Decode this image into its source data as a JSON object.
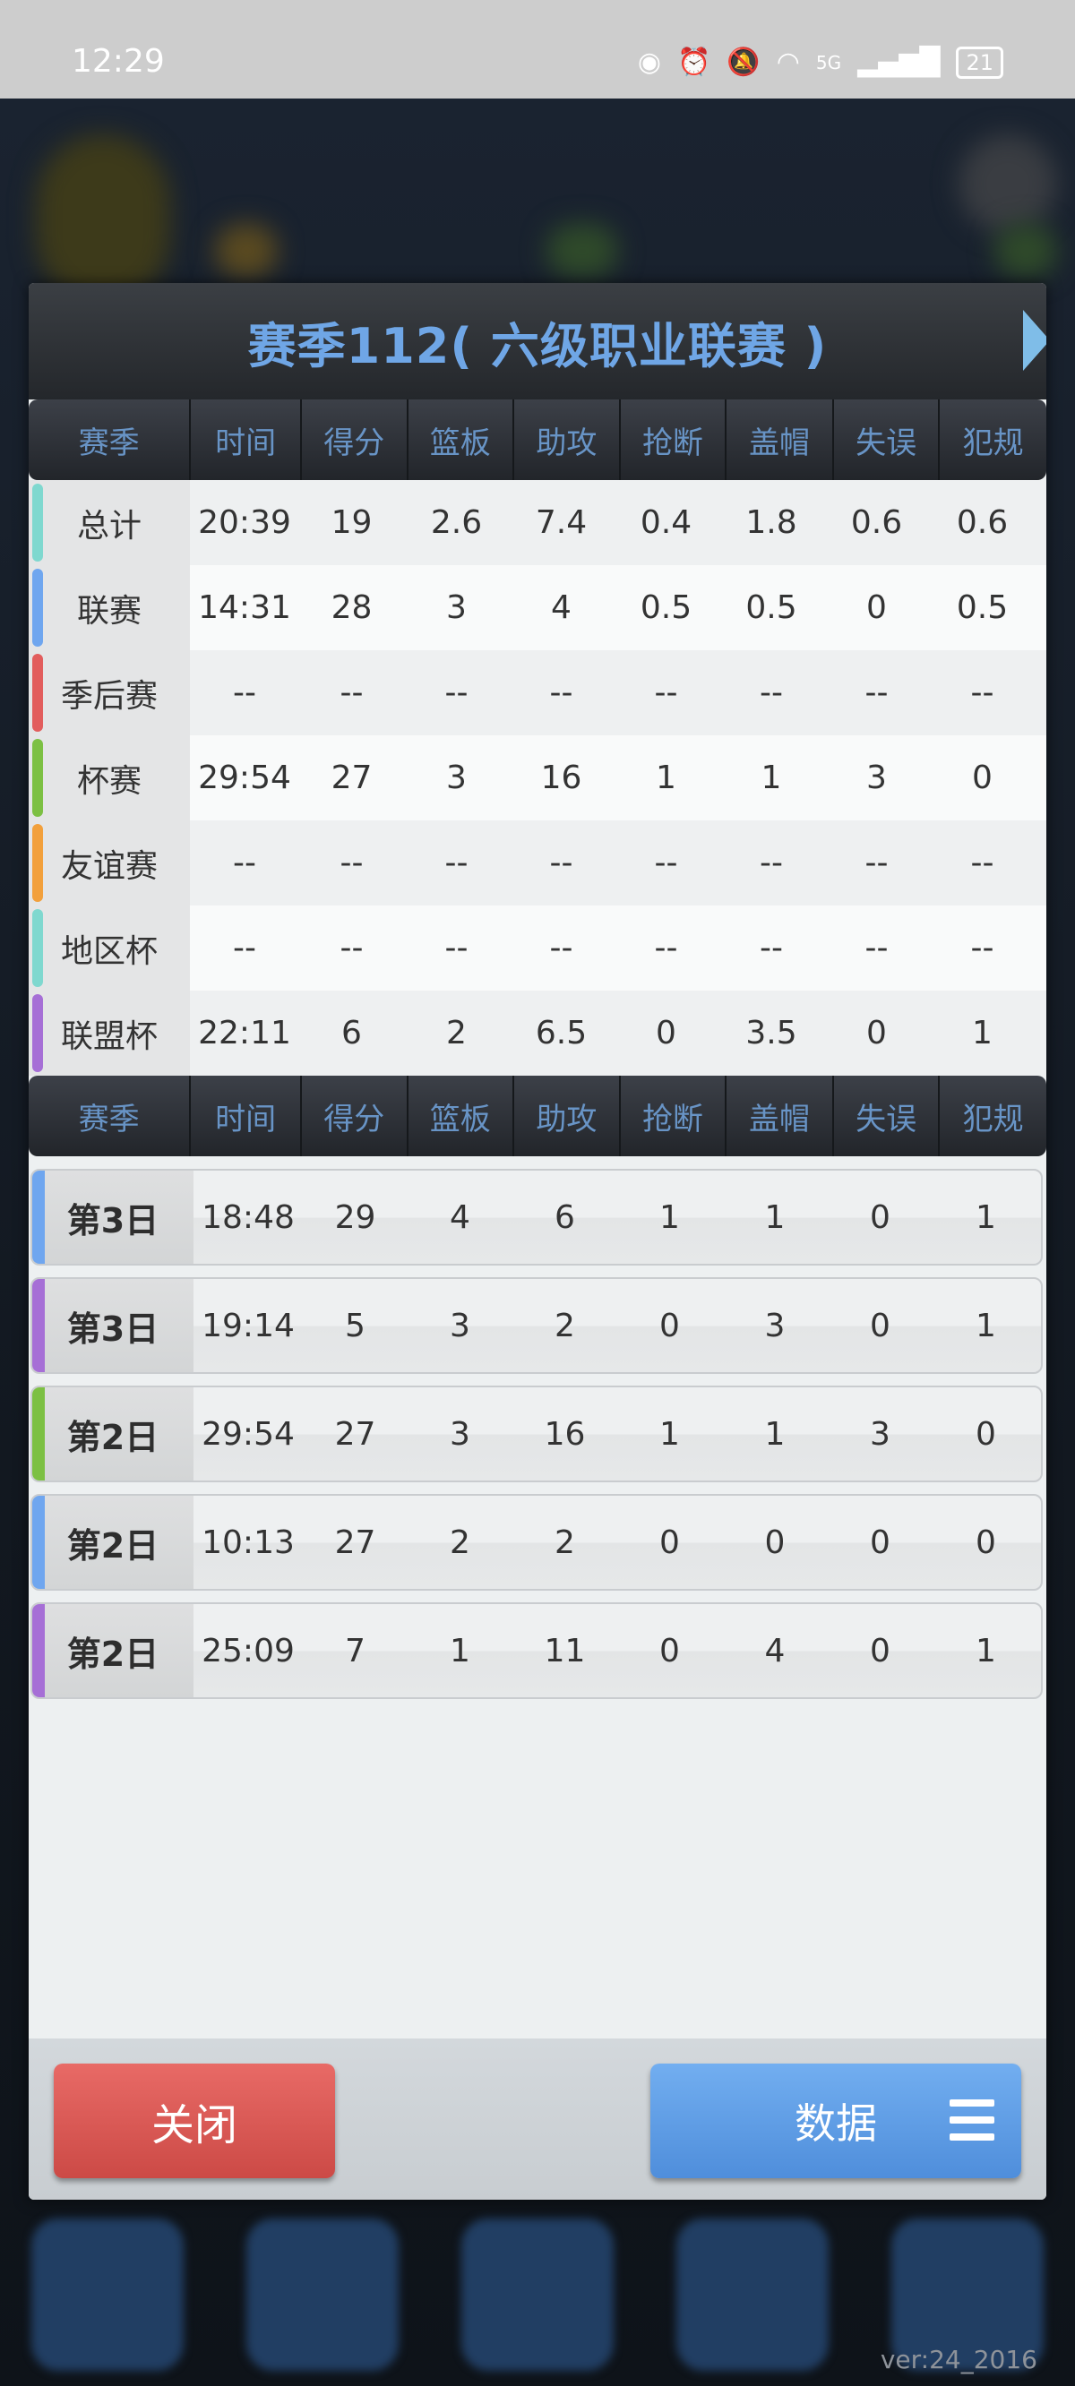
{
  "status_bar": {
    "time": "12:29",
    "battery": "21",
    "network": "5G"
  },
  "dialog": {
    "title": "赛季112( 六级职业联赛 )",
    "columns": [
      "赛季",
      "时间",
      "得分",
      "篮板",
      "助攻",
      "抢断",
      "盖帽",
      "失误",
      "犯规"
    ],
    "summary_rows": [
      {
        "label": "总计",
        "color": "#7fd8cf",
        "values": [
          "20:39",
          "19",
          "2.6",
          "7.4",
          "0.4",
          "1.8",
          "0.6",
          "0.6"
        ]
      },
      {
        "label": "联赛",
        "color": "#6fa6ef",
        "values": [
          "14:31",
          "28",
          "3",
          "4",
          "0.5",
          "0.5",
          "0",
          "0.5"
        ]
      },
      {
        "label": "季后赛",
        "color": "#e25d5d",
        "values": [
          "--",
          "--",
          "--",
          "--",
          "--",
          "--",
          "--",
          "--"
        ]
      },
      {
        "label": "杯赛",
        "color": "#7cc043",
        "values": [
          "29:54",
          "27",
          "3",
          "16",
          "1",
          "1",
          "3",
          "0"
        ]
      },
      {
        "label": "友谊赛",
        "color": "#f2a03c",
        "values": [
          "--",
          "--",
          "--",
          "--",
          "--",
          "--",
          "--",
          "--"
        ]
      },
      {
        "label": "地区杯",
        "color": "#7fd8cf",
        "values": [
          "--",
          "--",
          "--",
          "--",
          "--",
          "--",
          "--",
          "--"
        ]
      },
      {
        "label": "联盟杯",
        "color": "#a66fd6",
        "values": [
          "22:11",
          "6",
          "2",
          "6.5",
          "0",
          "3.5",
          "0",
          "1"
        ]
      }
    ],
    "game_rows": [
      {
        "label": "第3日",
        "color": "#6fa6ef",
        "values": [
          "18:48",
          "29",
          "4",
          "6",
          "1",
          "1",
          "0",
          "1"
        ]
      },
      {
        "label": "第3日",
        "color": "#a66fd6",
        "values": [
          "19:14",
          "5",
          "3",
          "2",
          "0",
          "3",
          "0",
          "1"
        ]
      },
      {
        "label": "第2日",
        "color": "#7cc043",
        "values": [
          "29:54",
          "27",
          "3",
          "16",
          "1",
          "1",
          "3",
          "0"
        ]
      },
      {
        "label": "第2日",
        "color": "#6fa6ef",
        "values": [
          "10:13",
          "27",
          "2",
          "2",
          "0",
          "0",
          "0",
          "0"
        ]
      },
      {
        "label": "第2日",
        "color": "#a66fd6",
        "values": [
          "25:09",
          "7",
          "1",
          "11",
          "0",
          "4",
          "0",
          "1"
        ]
      }
    ],
    "close_label": "关闭",
    "data_label": "数据"
  },
  "version": "ver:24_2016"
}
